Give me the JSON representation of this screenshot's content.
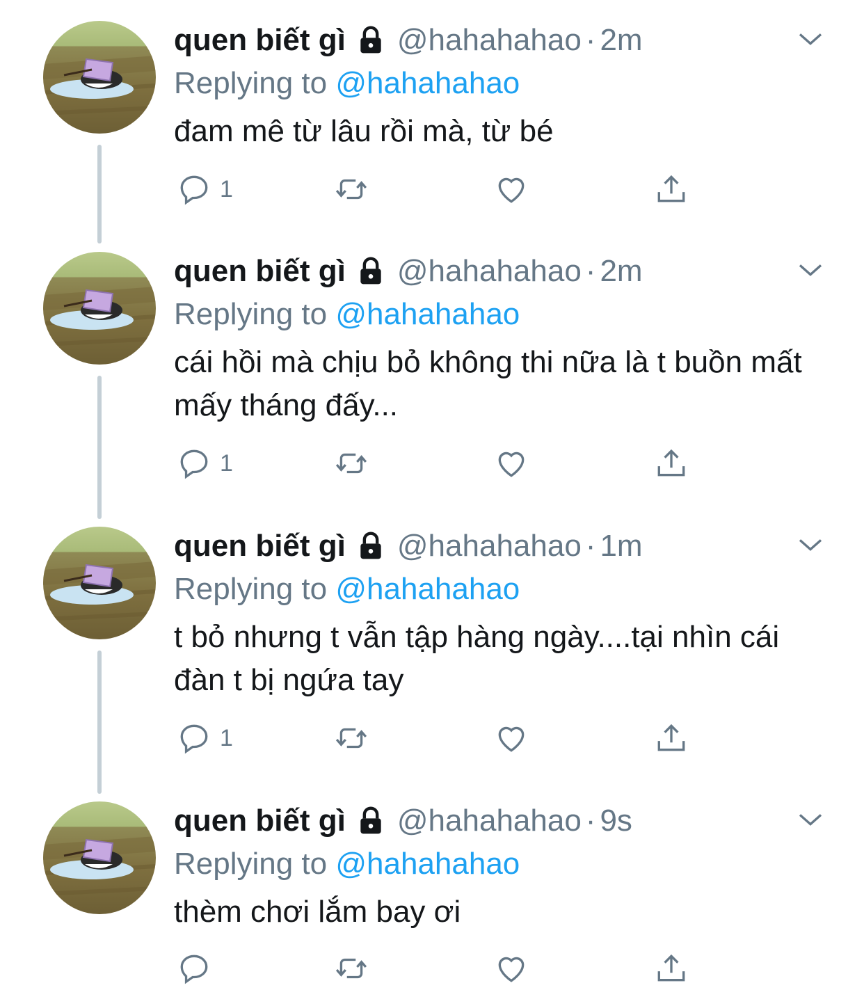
{
  "colors": {
    "accent": "#1da1f2",
    "secondary_text": "#657786",
    "thread_line": "#c4cfd6"
  },
  "icons": {
    "lock": "lock-icon",
    "chevron": "chevron-down-icon",
    "reply": "reply-icon",
    "retweet": "retweet-icon",
    "like": "heart-icon",
    "share": "share-icon"
  },
  "tweets": [
    {
      "display_name": "quen biết gì",
      "handle": "@hahahahao",
      "separator": "·",
      "time": "2m",
      "replying_prefix": "Replying to",
      "replying_to": "@hahahahao",
      "text": "đam mê từ lâu rồi mà, từ bé",
      "reply_count": "1"
    },
    {
      "display_name": "quen biết gì",
      "handle": "@hahahahao",
      "separator": "·",
      "time": "2m",
      "replying_prefix": "Replying to",
      "replying_to": "@hahahahao",
      "text": "cái hồi mà chịu bỏ không thi nữa là t buồn mất mấy tháng đấy...",
      "reply_count": "1"
    },
    {
      "display_name": "quen biết gì",
      "handle": "@hahahahao",
      "separator": "·",
      "time": "1m",
      "replying_prefix": "Replying to",
      "replying_to": "@hahahahao",
      "text": "t bỏ nhưng t vẫn tập hàng ngày....tại nhìn cái đàn t bị ngứa tay",
      "reply_count": "1"
    },
    {
      "display_name": "quen biết gì",
      "handle": "@hahahahao",
      "separator": "·",
      "time": "9s",
      "replying_prefix": "Replying to",
      "replying_to": "@hahahahao",
      "text": "thèm chơi lắm bay ơi",
      "reply_count": ""
    }
  ]
}
